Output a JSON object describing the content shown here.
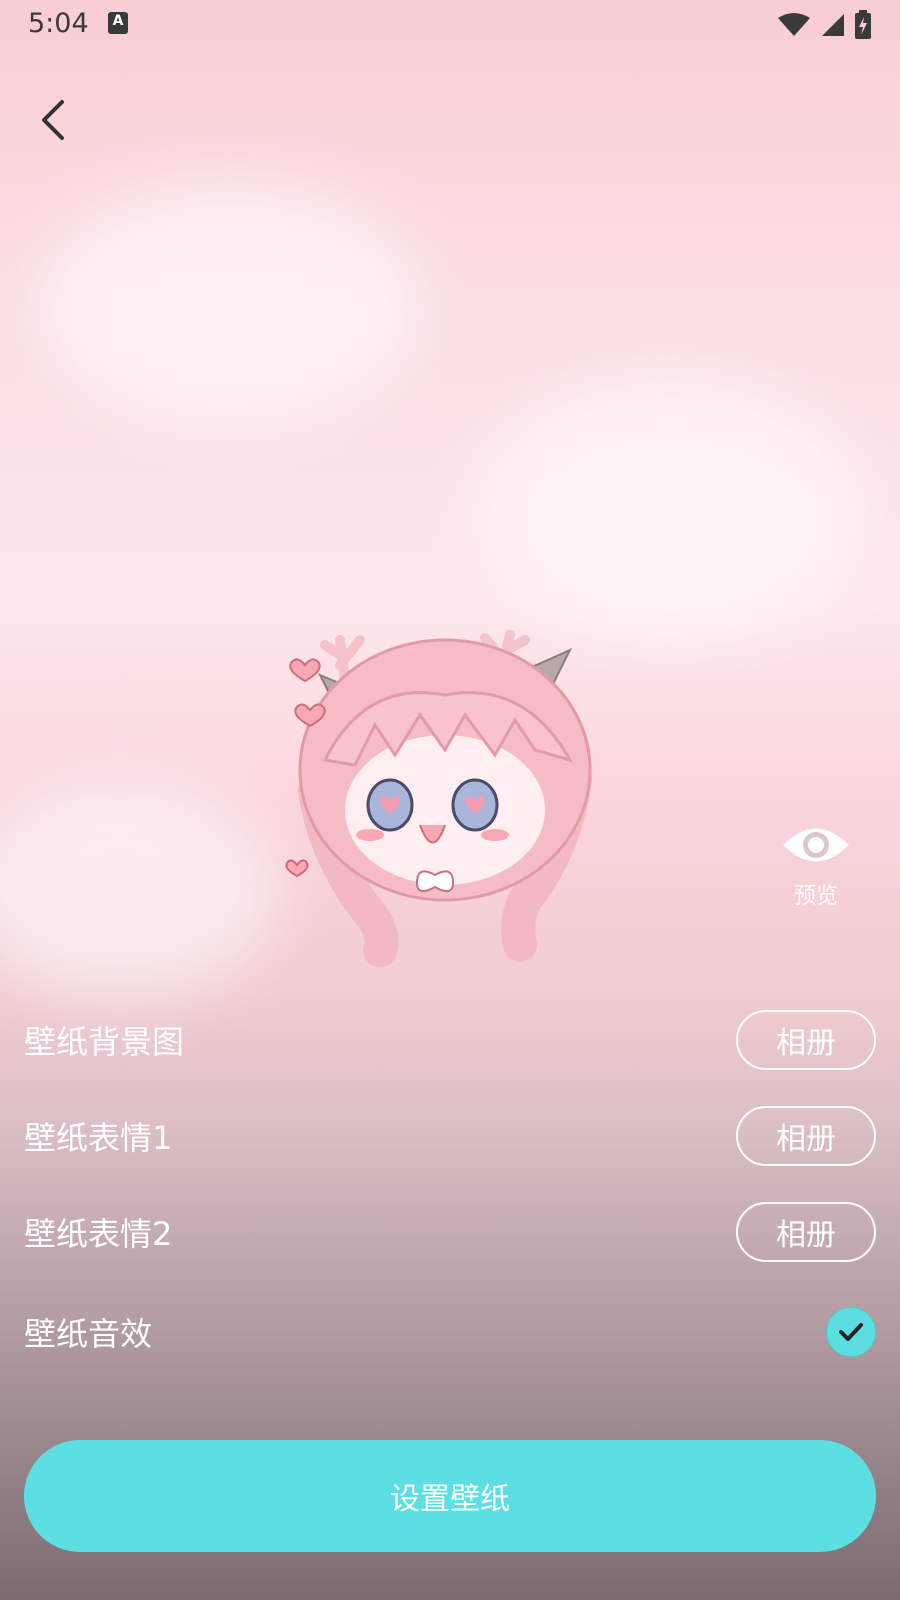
{
  "status_bar": {
    "time": "5:04",
    "notification_icon": "A"
  },
  "navigation": {
    "back_icon": "chevron-left-icon"
  },
  "preview": {
    "label": "预览",
    "icon": "eye-icon"
  },
  "settings": {
    "rows": [
      {
        "label": "壁纸背景图",
        "button": "相册"
      },
      {
        "label": "壁纸表情1",
        "button": "相册"
      },
      {
        "label": "壁纸表情2",
        "button": "相册"
      }
    ],
    "sound": {
      "label": "壁纸音效",
      "checked": true
    }
  },
  "primary_action": {
    "label": "设置壁纸"
  },
  "colors": {
    "accent": "#5bdfe3",
    "background_top": "#f8cdd3",
    "background_bottom": "#7b6b70"
  }
}
